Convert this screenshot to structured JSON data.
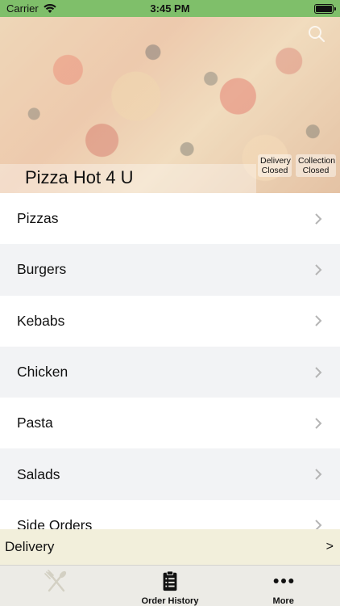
{
  "status_bar": {
    "carrier": "Carrier",
    "time": "3:45 PM"
  },
  "hero": {
    "restaurant_name": "Pizza Hot 4 U",
    "delivery_status": {
      "line1": "Delivery",
      "line2": "Closed"
    },
    "collection_status": {
      "line1": "Collection",
      "line2": "Closed"
    }
  },
  "menu": {
    "categories": [
      {
        "label": "Pizzas"
      },
      {
        "label": "Burgers"
      },
      {
        "label": "Kebabs"
      },
      {
        "label": "Chicken"
      },
      {
        "label": "Pasta"
      },
      {
        "label": "Salads"
      },
      {
        "label": "Side Orders"
      }
    ]
  },
  "order_mode": {
    "label": "Delivery",
    "arrow": ">"
  },
  "tab_bar": {
    "tabs": [
      {
        "label": "",
        "icon": "fork-knife-icon"
      },
      {
        "label": "Order History",
        "icon": "clipboard-list-icon"
      },
      {
        "label": "More",
        "icon": "more-dots-icon"
      }
    ]
  },
  "colors": {
    "status_bar": "#7fbf6a",
    "delivery_bar": "#f2efdb",
    "tab_bar": "#ecebe6"
  }
}
